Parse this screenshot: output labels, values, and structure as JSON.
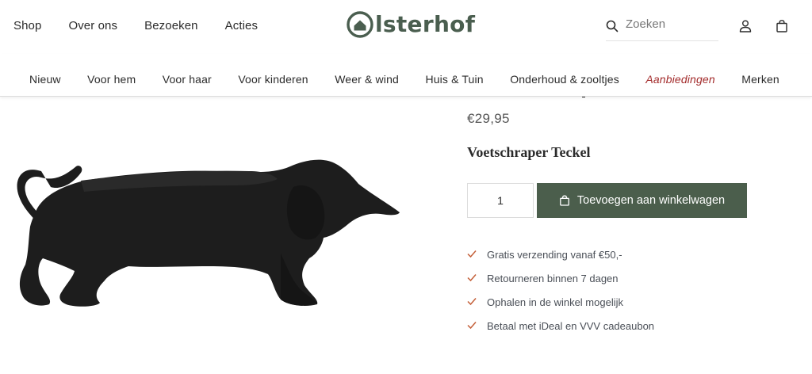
{
  "header": {
    "top_nav": [
      "Shop",
      "Over ons",
      "Bezoeken",
      "Acties"
    ],
    "logo_text": "lsterhof",
    "search_placeholder": "Zoeken",
    "icons": [
      "search-icon",
      "account-icon",
      "cart-bag-icon"
    ]
  },
  "category_nav": {
    "items": [
      "Nieuw",
      "Voor hem",
      "Voor haar",
      "Voor kinderen",
      "Weer & wind",
      "Huis & Tuin",
      "Onderhoud & zooltjes",
      "Aanbiedingen",
      "Merken"
    ],
    "highlight_color": "#a32b2b"
  },
  "product": {
    "price": "€29,95",
    "name": "Voetschraper Teckel",
    "quantity": "1",
    "add_to_cart_label": "Toevoegen aan winkelwagen",
    "image_alt": "dachshund-shaped cast iron boot scraper",
    "usps": [
      "Gratis verzending vanaf €50,-",
      "Retourneren binnen 7 dagen",
      "Ophalen in de winkel mogelijk",
      "Betaal met iDeal en VVV cadeaubon"
    ]
  },
  "colors": {
    "brand_green": "#4b5e4c",
    "check_orange": "#c4603a",
    "sale_red": "#a32b2b"
  }
}
